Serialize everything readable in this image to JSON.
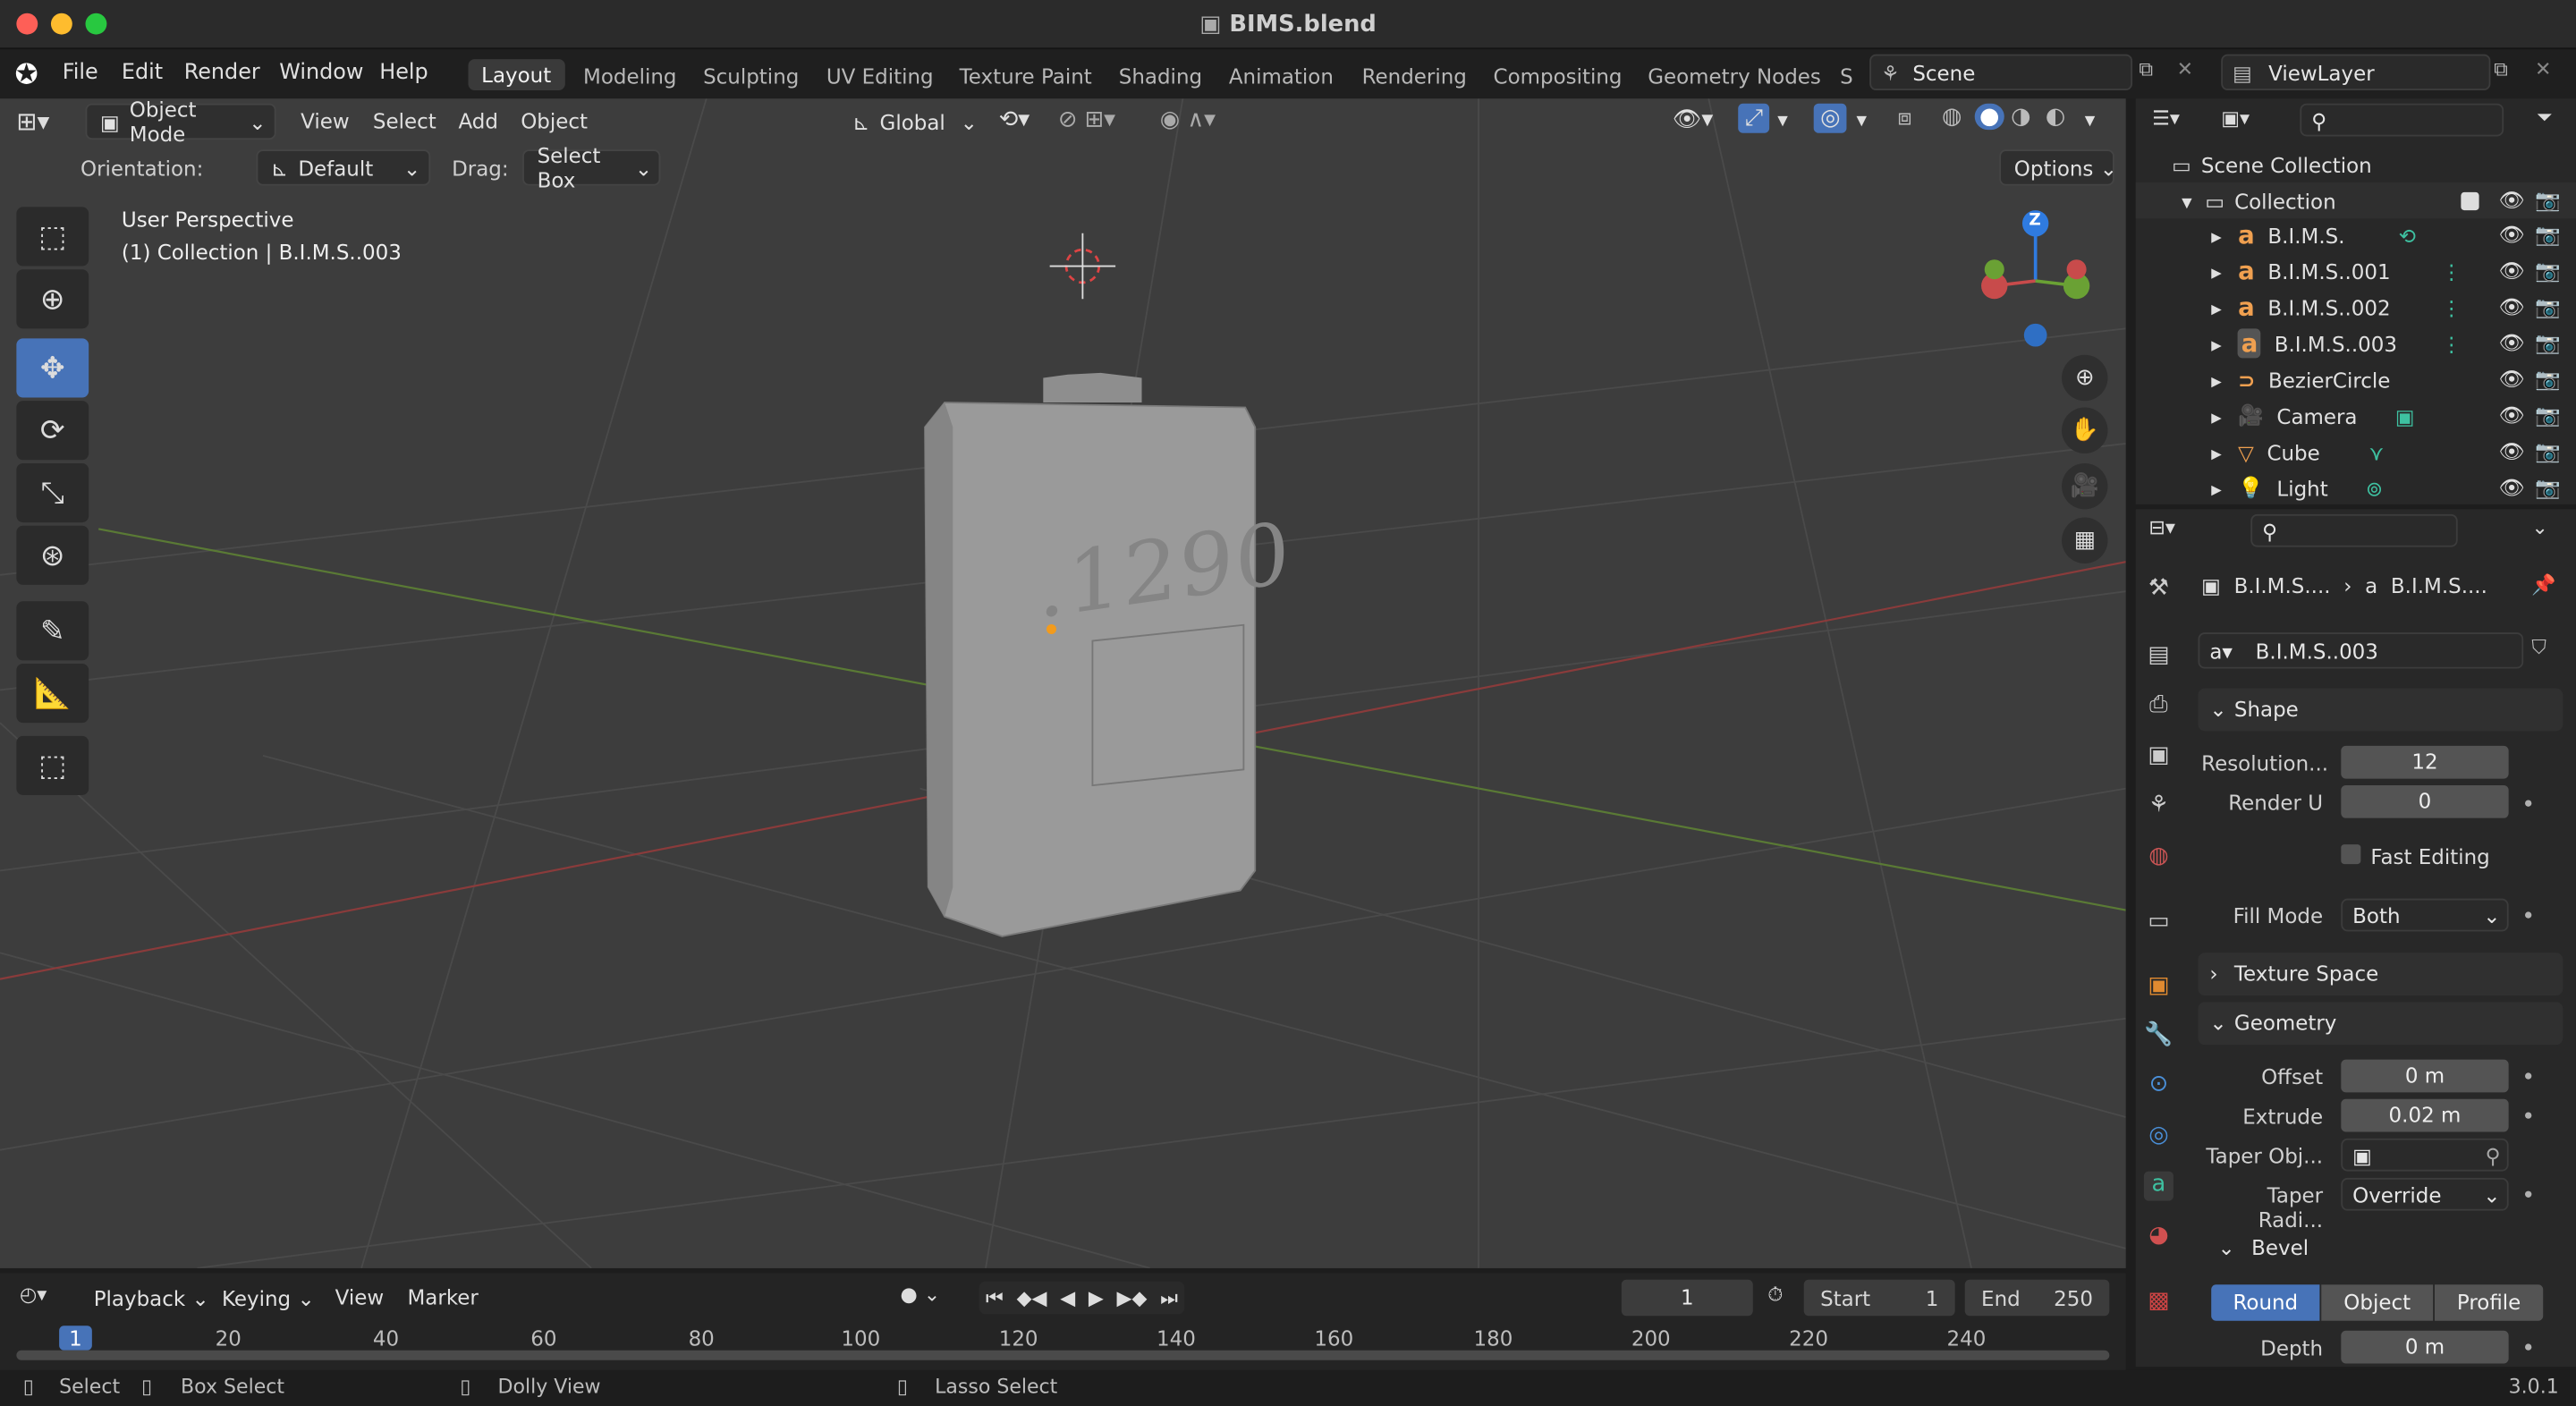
{
  "window": {
    "title": "BIMS.blend"
  },
  "menu": [
    "File",
    "Edit",
    "Render",
    "Window",
    "Help"
  ],
  "workspaces": [
    "Layout",
    "Modeling",
    "Sculpting",
    "UV Editing",
    "Texture Paint",
    "Shading",
    "Animation",
    "Rendering",
    "Compositing",
    "Geometry Nodes",
    "S"
  ],
  "scene": {
    "name": "Scene",
    "view_layer": "ViewLayer"
  },
  "viewport": {
    "mode": "Object Mode",
    "menus": [
      "View",
      "Select",
      "Add",
      "Object"
    ],
    "transform_orientation": "Global",
    "orientation_label": "Orientation:",
    "orientation_value": "Default",
    "drag_label": "Drag:",
    "drag_value": "Select Box",
    "options": "Options",
    "overlay_line1": "User Perspective",
    "overlay_line2": "(1) Collection | B.I.M.S..003",
    "object_text": ".1290",
    "gizmo_z": "Z"
  },
  "outliner": {
    "root": "Scene Collection",
    "collection": "Collection",
    "items": [
      {
        "name": "B.I.M.S.",
        "icon": "text-curve-icon"
      },
      {
        "name": "B.I.M.S..001",
        "icon": "text-curve-icon"
      },
      {
        "name": "B.I.M.S..002",
        "icon": "text-curve-icon"
      },
      {
        "name": "B.I.M.S..003",
        "icon": "text-curve-icon"
      },
      {
        "name": "BezierCircle",
        "icon": "curve-icon"
      },
      {
        "name": "Camera",
        "icon": "camera-icon"
      },
      {
        "name": "Cube",
        "icon": "mesh-icon"
      },
      {
        "name": "Light",
        "icon": "light-icon"
      }
    ]
  },
  "properties": {
    "breadcrumb1": "B.I.M.S....",
    "breadcrumb2": "B.I.M.S....",
    "datablock": "B.I.M.S..003",
    "shape": {
      "title": "Shape",
      "resolution_label": "Resolution...",
      "resolution_value": "12",
      "render_u_label": "Render U",
      "render_u_value": "0",
      "fast_editing": "Fast Editing",
      "fill_mode_label": "Fill Mode",
      "fill_mode_value": "Both"
    },
    "texture_space": "Texture Space",
    "geometry": {
      "title": "Geometry",
      "offset_label": "Offset",
      "offset_value": "0 m",
      "extrude_label": "Extrude",
      "extrude_value": "0.02 m",
      "taper_obj_label": "Taper Obj...",
      "taper_radius_label": "Taper Radi...",
      "taper_radius_value": "Override"
    },
    "bevel": {
      "title": "Bevel",
      "modes": [
        "Round",
        "Object",
        "Profile"
      ],
      "depth_label": "Depth",
      "depth_value": "0 m"
    }
  },
  "timeline": {
    "menus": [
      "Playback",
      "Keying",
      "View",
      "Marker"
    ],
    "current_frame": "1",
    "start_label": "Start",
    "start_value": "1",
    "end_label": "End",
    "end_value": "250",
    "ruler": [
      "1",
      "20",
      "40",
      "60",
      "80",
      "100",
      "120",
      "140",
      "160",
      "180",
      "200",
      "220",
      "240"
    ]
  },
  "statusbar": {
    "items": [
      "Select",
      "Box Select",
      "Dolly View",
      "Lasso Select"
    ],
    "version": "3.0.1"
  }
}
